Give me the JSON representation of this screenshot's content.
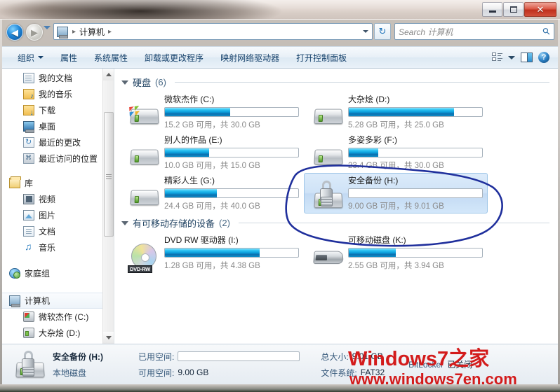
{
  "window": {
    "controls": {
      "minimize": "–",
      "maximize": "❑",
      "close": "✕"
    }
  },
  "navigation": {
    "back_icon": "◀",
    "forward_icon": "▶",
    "history_dropdown": "chevron-down-icon",
    "breadcrumb": {
      "computer_icon": "computer-icon",
      "root": "计算机",
      "sep": "▸"
    },
    "refresh_icon": "↻",
    "search": {
      "placeholder": "Search 计算机",
      "icon": "search-icon"
    }
  },
  "toolbar": {
    "items": [
      {
        "label": "组织",
        "has_dropdown": true
      },
      {
        "label": "属性",
        "has_dropdown": false
      },
      {
        "label": "系统属性",
        "has_dropdown": false
      },
      {
        "label": "卸载或更改程序",
        "has_dropdown": false
      },
      {
        "label": "映射网络驱动器",
        "has_dropdown": false
      },
      {
        "label": "打开控制面板",
        "has_dropdown": false
      }
    ],
    "views_icon": "views-icon",
    "views_dropdown_icon": "chevron-down-icon",
    "preview_pane_icon": "preview-pane-icon",
    "help_icon": "help-icon",
    "help_glyph": "?"
  },
  "sidebar": {
    "items": [
      {
        "label": "我的文档",
        "icon": "documents-icon",
        "indent": "deep",
        "selected": false
      },
      {
        "label": "我的音乐",
        "icon": "music-folder-icon",
        "indent": "deep",
        "selected": false
      },
      {
        "label": "下载",
        "icon": "downloads-icon",
        "indent": "deep",
        "selected": false
      },
      {
        "label": "桌面",
        "icon": "desktop-icon",
        "indent": "deep",
        "selected": false
      },
      {
        "label": "最近的更改",
        "icon": "recent-changes-icon",
        "indent": "deep",
        "selected": false
      },
      {
        "label": "最近访问的位置",
        "icon": "recent-places-icon",
        "indent": "deep",
        "selected": false
      },
      {
        "label": "",
        "icon": "spacer",
        "indent": "spacer",
        "selected": false
      },
      {
        "label": "库",
        "icon": "library-icon",
        "indent": "root",
        "selected": false
      },
      {
        "label": "视频",
        "icon": "video-icon",
        "indent": "deep",
        "selected": false
      },
      {
        "label": "图片",
        "icon": "pictures-icon",
        "indent": "deep",
        "selected": false
      },
      {
        "label": "文档",
        "icon": "documents-library-icon",
        "indent": "deep",
        "selected": false
      },
      {
        "label": "音乐",
        "icon": "music-note-icon",
        "indent": "deep",
        "selected": false
      },
      {
        "label": "",
        "icon": "spacer",
        "indent": "spacer",
        "selected": false
      },
      {
        "label": "家庭组",
        "icon": "homegroup-icon",
        "indent": "root",
        "selected": false
      },
      {
        "label": "",
        "icon": "spacer",
        "indent": "spacer",
        "selected": false
      },
      {
        "label": "计算机",
        "icon": "computer-icon",
        "indent": "root",
        "selected": true
      },
      {
        "label": "微软杰作 (C:)",
        "icon": "hdd-windows-icon",
        "indent": "deep",
        "selected": false
      },
      {
        "label": "大杂烩 (D:)",
        "icon": "hdd-icon",
        "indent": "deep",
        "selected": false
      }
    ],
    "scrollbar": {
      "up_icon": "scroll-up-icon",
      "down_icon": "scroll-down-icon"
    }
  },
  "content": {
    "groups": [
      {
        "name": "硬盘",
        "count": "(6)",
        "drives": [
          {
            "name": "微软杰作 (C:)",
            "sub": "15.2 GB 可用，共 30.0 GB",
            "fill_pct": 49,
            "icon": "hdd-windows-icon",
            "selected": false
          },
          {
            "name": "大杂烩 (D:)",
            "sub": "5.28 GB 可用，共 25.0 GB",
            "fill_pct": 79,
            "icon": "hdd-icon",
            "selected": false
          },
          {
            "name": "别人的作品 (E:)",
            "sub": "10.0 GB 可用，共 15.0 GB",
            "fill_pct": 33,
            "icon": "hdd-icon",
            "selected": false
          },
          {
            "name": "多姿多彩 (F:)",
            "sub": "23.4 GB 可用，共 30.0 GB",
            "fill_pct": 22,
            "icon": "hdd-icon",
            "selected": false
          },
          {
            "name": "精彩人生 (G:)",
            "sub": "24.4 GB 可用，共 40.0 GB",
            "fill_pct": 39,
            "icon": "hdd-icon",
            "selected": false
          },
          {
            "name": "安全备份 (H:)",
            "sub": "9.00 GB 可用，共 9.01 GB",
            "fill_pct": 0,
            "icon": "hdd-locked-icon",
            "selected": true
          }
        ]
      },
      {
        "name": "有可移动存储的设备",
        "count": "(2)",
        "drives": [
          {
            "name": "DVD RW 驱动器 (I:)",
            "sub": "1.28 GB 可用，共 4.38 GB",
            "fill_pct": 71,
            "icon": "dvd-rw-icon",
            "dvd_label": "DVD-RW",
            "selected": false
          },
          {
            "name": "可移动磁盘 (K:)",
            "sub": "2.55 GB 可用，共 3.94 GB",
            "fill_pct": 35,
            "icon": "usb-drive-icon",
            "selected": false
          }
        ]
      }
    ],
    "annotation": {
      "shape": "hand-drawn-ellipse",
      "color": "#1f2f9c"
    }
  },
  "details": {
    "icon": "hdd-locked-icon",
    "title": "安全备份 (H:)",
    "subtitle": "本地磁盘",
    "used_label": "已用空间:",
    "free_label": "可用空间:",
    "free_value": "9.00 GB",
    "total_label": "总大小:",
    "total_value": "9.01 GB",
    "fs_label": "文件系统:",
    "fs_value": "FAT32",
    "bitlocker_label": "BitLocker",
    "bitlocker_value": "已关闭"
  },
  "watermark": {
    "line1": "Windows7之家",
    "line2": "www.windows7en.com"
  },
  "colors": {
    "accent_blue": "#0c9fdc",
    "selection_blue": "#cfe3f7",
    "annotation": "#1f2f9c",
    "toolbar_text": "#15416b"
  }
}
